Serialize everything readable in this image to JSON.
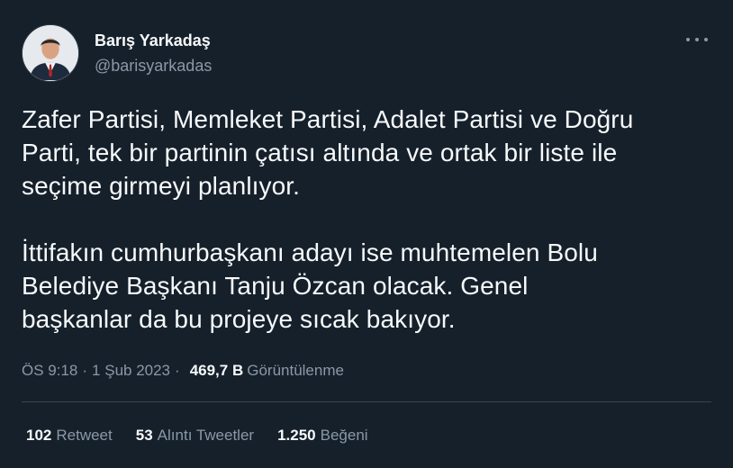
{
  "author": {
    "display_name": "Barış Yarkadaş",
    "handle": "@barisyarkadas"
  },
  "tweet": {
    "paragraph1": [
      "Zafer Partisi, Memleket Partisi, Adalet Partisi ve Doğru",
      "Parti, tek bir partinin çatısı altında ve ortak bir liste ile",
      "seçime girmeyi planlıyor."
    ],
    "paragraph2": [
      "İttifakın cumhurbaşkanı adayı ise muhtemelen Bolu",
      "Belediye Başkanı Tanju Özcan olacak. Genel",
      "başkanlar da bu projeye sıcak bakıyor."
    ]
  },
  "meta": {
    "time": "ÖS 9:18",
    "separator": "·",
    "date": "1 Şub 2023",
    "views_count": "469,7 B",
    "views_label": "Görüntülenme"
  },
  "stats": {
    "retweets_count": "102",
    "retweets_label": "Retweet",
    "quotes_count": "53",
    "quotes_label": "Alıntı Tweetler",
    "likes_count": "1.250",
    "likes_label": "Beğeni"
  },
  "icons": {
    "more": "more-horizontal-icon"
  },
  "colors": {
    "background": "#15202b",
    "text": "#f7f9f9",
    "secondary": "#8b98a5",
    "divider": "#38444d"
  }
}
